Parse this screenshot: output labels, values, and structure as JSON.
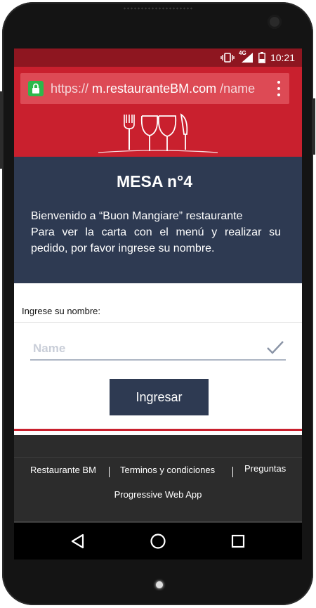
{
  "status_bar": {
    "network": "4G",
    "time": "10:21"
  },
  "browser": {
    "url_scheme": "https://",
    "url_host": "m.restauranteBM.com",
    "url_path": "/name",
    "secure_icon": "lock-icon",
    "menu_icon": "more-vert-icon"
  },
  "banner": {
    "logo_icon": "fork-wineglass-knife-icon"
  },
  "hero": {
    "title": "MESA n°4",
    "welcome_line": "Bienvenido a “Buon Mangiare” restaurante",
    "instructions": "Para ver la carta con el menú y realizar su pedido, por favor ingrese su nombre."
  },
  "form": {
    "label": "Ingrese su nombre:",
    "name_placeholder": "Name",
    "name_value": "",
    "submit_label": "Ingresar"
  },
  "footer": {
    "links": [
      "Restaurante BM",
      "Terminos y condiciones",
      "Preguntas"
    ],
    "subtitle": "Progressive Web App"
  },
  "nav": {
    "back_icon": "back-triangle-icon",
    "home_icon": "home-circle-icon",
    "recents_icon": "recents-square-icon"
  },
  "colors": {
    "brand_red": "#c9202e",
    "status_red": "#8e1620",
    "navy": "#2e3a52",
    "footer_dark": "#2c2c2c",
    "secure_green": "#2db84b"
  }
}
